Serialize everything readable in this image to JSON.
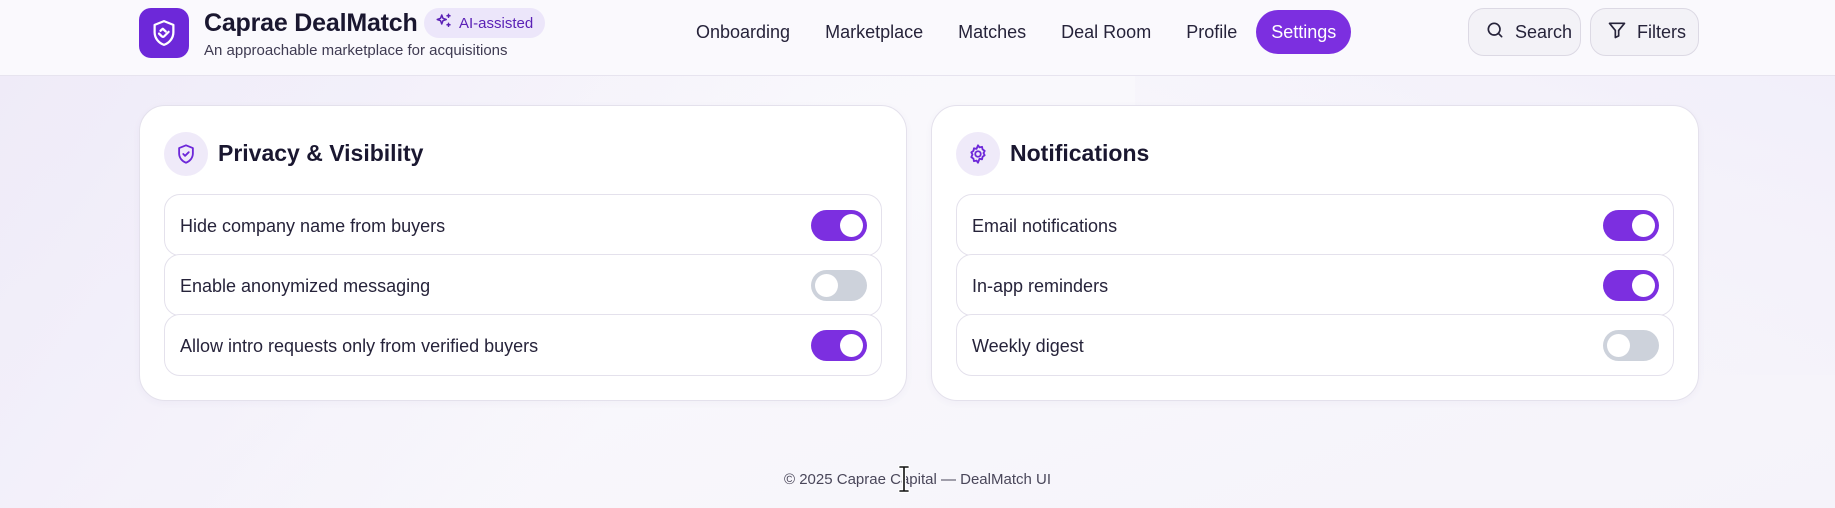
{
  "app": {
    "title": "Caprae DealMatch",
    "subtitle": "An approachable marketplace for acquisitions",
    "badge": "AI-assisted"
  },
  "nav": {
    "items": [
      {
        "label": "Onboarding",
        "active": false
      },
      {
        "label": "Marketplace",
        "active": false
      },
      {
        "label": "Matches",
        "active": false
      },
      {
        "label": "Deal Room",
        "active": false
      },
      {
        "label": "Profile",
        "active": false
      },
      {
        "label": "Settings",
        "active": true
      }
    ]
  },
  "toolbar": {
    "search_label": "Search",
    "filters_label": "Filters"
  },
  "privacy": {
    "title": "Privacy & Visibility",
    "items": [
      {
        "label": "Hide company name from buyers",
        "enabled": true
      },
      {
        "label": "Enable anonymized messaging",
        "enabled": false
      },
      {
        "label": "Allow intro requests only from verified buyers",
        "enabled": true
      }
    ]
  },
  "notifications": {
    "title": "Notifications",
    "items": [
      {
        "label": "Email notifications",
        "enabled": true
      },
      {
        "label": "In-app reminders",
        "enabled": true
      },
      {
        "label": "Weekly digest",
        "enabled": false
      }
    ]
  },
  "footer": {
    "text": "© 2025 Caprae Capital — DealMatch UI"
  },
  "colors": {
    "accent": "#7c2fe0",
    "accent_dark": "#6d28d9",
    "toggle_off": "#cdd2db"
  },
  "icons": {
    "logo": "handshake-shield-icon",
    "badge": "sparkles-icon",
    "search": "search-icon",
    "filters": "filter-icon",
    "privacy": "shield-check-icon",
    "notifications": "gear-icon"
  }
}
